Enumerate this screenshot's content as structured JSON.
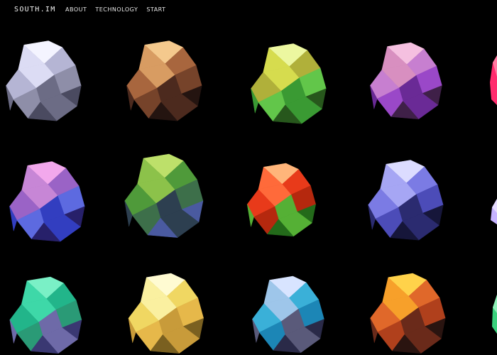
{
  "site": {
    "logo": "SOUTH.IM",
    "nav": [
      {
        "label": "ABOUT"
      },
      {
        "label": "TECHNOLOGY"
      },
      {
        "label": "START"
      }
    ]
  },
  "gems": [
    {
      "colors": [
        "#f4f4ff",
        "#dcdcf4",
        "#b5b5d4",
        "#8e8ea8",
        "#6c6c85",
        "#4a4a60"
      ]
    },
    {
      "colors": [
        "#f4c98d",
        "#d89c62",
        "#a8663e",
        "#76432a",
        "#4c2a1e",
        "#241410"
      ]
    },
    {
      "colors": [
        "#ecf7a0",
        "#d6dc4e",
        "#b0b03a",
        "#62c64a",
        "#3a9a33",
        "#27571c"
      ]
    },
    {
      "colors": [
        "#f5c0e0",
        "#d88fc0",
        "#c77fd0",
        "#9a48c8",
        "#6a2a96",
        "#3f2048"
      ]
    },
    {
      "colors": [
        "#f2a8ec",
        "#c786d6",
        "#9a63c6",
        "#5d6ae0",
        "#323ec0",
        "#27206a"
      ]
    },
    {
      "colors": [
        "#bde06a",
        "#8cc24a",
        "#4f9a3a",
        "#3d6f4a",
        "#2d3f50",
        "#4a5aa0"
      ]
    },
    {
      "colors": [
        "#ffb57a",
        "#ff6a3a",
        "#e83a1a",
        "#b5280e",
        "#55b035",
        "#236a1a"
      ]
    },
    {
      "colors": [
        "#dcdcff",
        "#a6a6f4",
        "#7b7be4",
        "#4c4cb8",
        "#2b2b70",
        "#16163a"
      ]
    },
    {
      "colors": [
        "#7af0c6",
        "#3ed8a8",
        "#22b58a",
        "#2a9a76",
        "#6e6aa8",
        "#3a3872"
      ]
    },
    {
      "colors": [
        "#fffbd2",
        "#faf0a0",
        "#f0d762",
        "#e6b84a",
        "#c89b3a",
        "#7a6020"
      ]
    },
    {
      "colors": [
        "#d8e4ff",
        "#9ec6ea",
        "#3ab0d8",
        "#1c86b6",
        "#5a5a7a",
        "#2a2a48"
      ]
    },
    {
      "colors": [
        "#ffd24a",
        "#f7a02a",
        "#e0682a",
        "#b0401c",
        "#6a2a1a",
        "#2a1410"
      ]
    }
  ]
}
